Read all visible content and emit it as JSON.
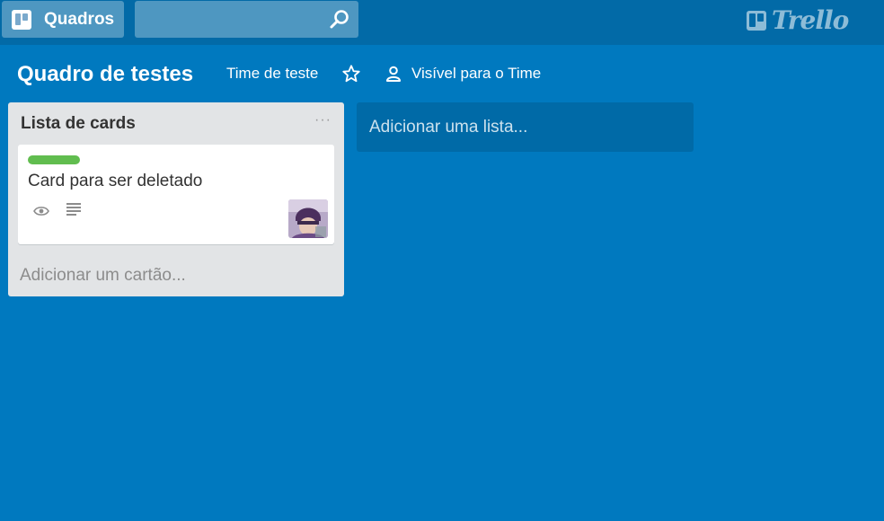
{
  "header": {
    "boards_label": "Quadros",
    "search_value": "",
    "logo_text": "Trello"
  },
  "board": {
    "title": "Quadro de testes",
    "team": "Time de teste",
    "visibility": "Visível para o Time"
  },
  "list": {
    "title": "Lista de cards",
    "menu_label": "···",
    "cards": [
      {
        "label_color": "#61bd4f",
        "title": "Card para ser deletado",
        "badges": [
          "eye-icon",
          "description-icon"
        ],
        "has_member_avatar": true
      }
    ],
    "add_card_label": "Adicionar um cartão..."
  },
  "add_list_label": "Adicionar uma lista...",
  "colors": {
    "board_background": "#0079bf",
    "header_background": "#026aa7",
    "list_background": "#e2e4e6",
    "label_green": "#61bd4f"
  }
}
